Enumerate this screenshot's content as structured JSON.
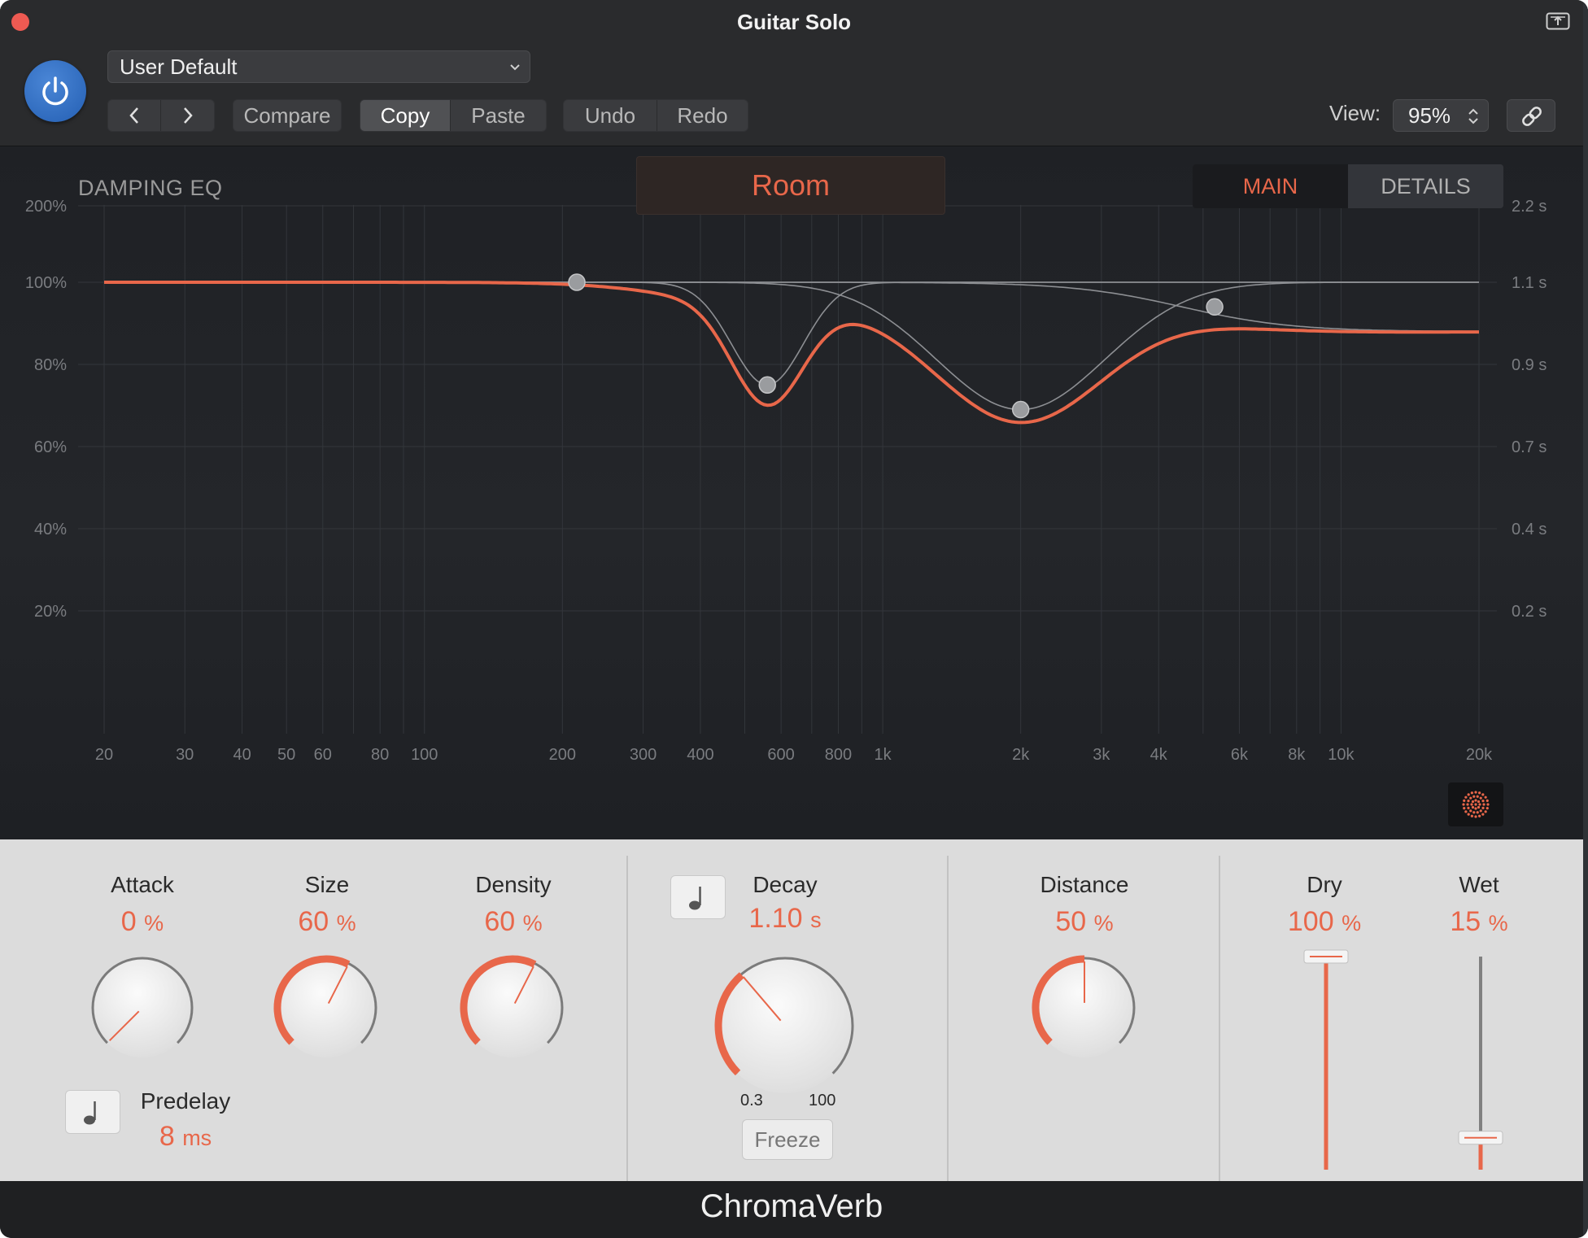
{
  "window": {
    "title": "Guitar Solo"
  },
  "header": {
    "preset": "User Default",
    "nav_prev": "<",
    "nav_next": ">",
    "compare": "Compare",
    "copy": "Copy",
    "paste": "Paste",
    "undo": "Undo",
    "redo": "Redo",
    "view_label": "View:",
    "view_value": "95%"
  },
  "eq": {
    "title": "DAMPING EQ",
    "room": "Room",
    "tab_main": "MAIN",
    "tab_details": "DETAILS",
    "left_axis": [
      "200%",
      "100%",
      "80%",
      "60%",
      "40%",
      "20%"
    ],
    "right_axis": [
      "2.2 s",
      "1.1 s",
      "0.9 s",
      "0.7 s",
      "0.4 s",
      "0.2 s"
    ],
    "freq_labels": [
      "20",
      "30",
      "40",
      "50",
      "60",
      "80",
      "100",
      "200",
      "300",
      "400",
      "600",
      "800",
      "1k",
      "2k",
      "3k",
      "4k",
      "6k",
      "8k",
      "10k",
      "20k"
    ],
    "bands": [
      {
        "freq_hz": 215,
        "percent": 100
      },
      {
        "freq_hz": 560,
        "percent": 75
      },
      {
        "freq_hz": 2000,
        "percent": 69
      },
      {
        "freq_hz": 5300,
        "percent": 94
      }
    ],
    "curve_color": "#e8674a"
  },
  "controls": {
    "attack": {
      "label": "Attack",
      "value": "0",
      "unit": "%",
      "amount": 0
    },
    "size": {
      "label": "Size",
      "value": "60",
      "unit": "%",
      "amount": 0.6
    },
    "density": {
      "label": "Density",
      "value": "60",
      "unit": "%",
      "amount": 0.6
    },
    "decay": {
      "label": "Decay",
      "value": "1.10",
      "unit": "s",
      "amount": 0.35,
      "range_min": "0.3",
      "range_max": "100",
      "freeze": "Freeze"
    },
    "distance": {
      "label": "Distance",
      "value": "50",
      "unit": "%",
      "amount": 0.5
    },
    "dry": {
      "label": "Dry",
      "value": "100",
      "unit": "%",
      "amount": 1.0
    },
    "wet": {
      "label": "Wet",
      "value": "15",
      "unit": "%",
      "amount": 0.15
    },
    "predelay": {
      "label": "Predelay",
      "value": "8",
      "unit": "ms"
    }
  },
  "footer": {
    "product": "ChromaVerb"
  },
  "colors": {
    "accent": "#e8674a",
    "power": "#2f6cc0"
  }
}
